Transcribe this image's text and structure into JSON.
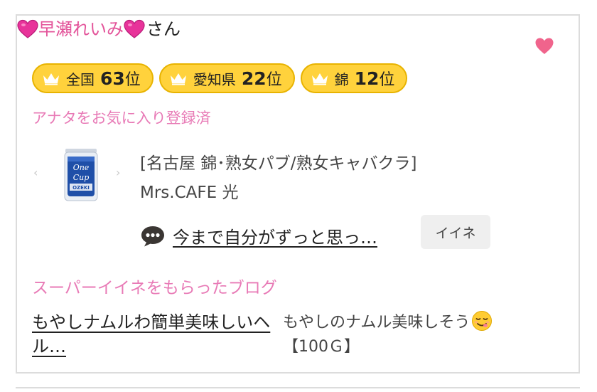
{
  "user": {
    "name": "早瀬れいみ",
    "suffix": "さん"
  },
  "badges": [
    {
      "area": "全国",
      "rank": "63",
      "suffix": "位"
    },
    {
      "area": "愛知県",
      "rank": "22",
      "suffix": "位"
    },
    {
      "area": "錦",
      "rank": "12",
      "suffix": "位"
    }
  ],
  "favorite_status": "アナタをお気に入り登録済",
  "carousel": {
    "prev": "‹",
    "next": "›"
  },
  "shop": {
    "category": "[名古屋 錦･熟女パブ/熟女キャバクラ]",
    "name": "Mrs.CAFE 光"
  },
  "comment": {
    "text": "今まで自分がずっと思っ…",
    "like_label": "イイネ"
  },
  "super_like_section": {
    "title": "スーパーイイネをもらったブログ",
    "blog_title": "もやしナムルわ簡単美味しいヘル…",
    "excerpt_text": "もやしのナムル美味しそう",
    "excerpt_extra": "【100Ｇ】"
  },
  "colors": {
    "pink_text": "#e3549a",
    "pink_light": "#e87ab6",
    "badge_bg": "#ffd23c",
    "badge_border": "#e8b300",
    "heart": "#f0648c"
  },
  "icons": [
    "heart-emoji",
    "favorite-heart-icon",
    "crown-icon",
    "comment-bubble-icon",
    "relieved-face-emoji"
  ]
}
